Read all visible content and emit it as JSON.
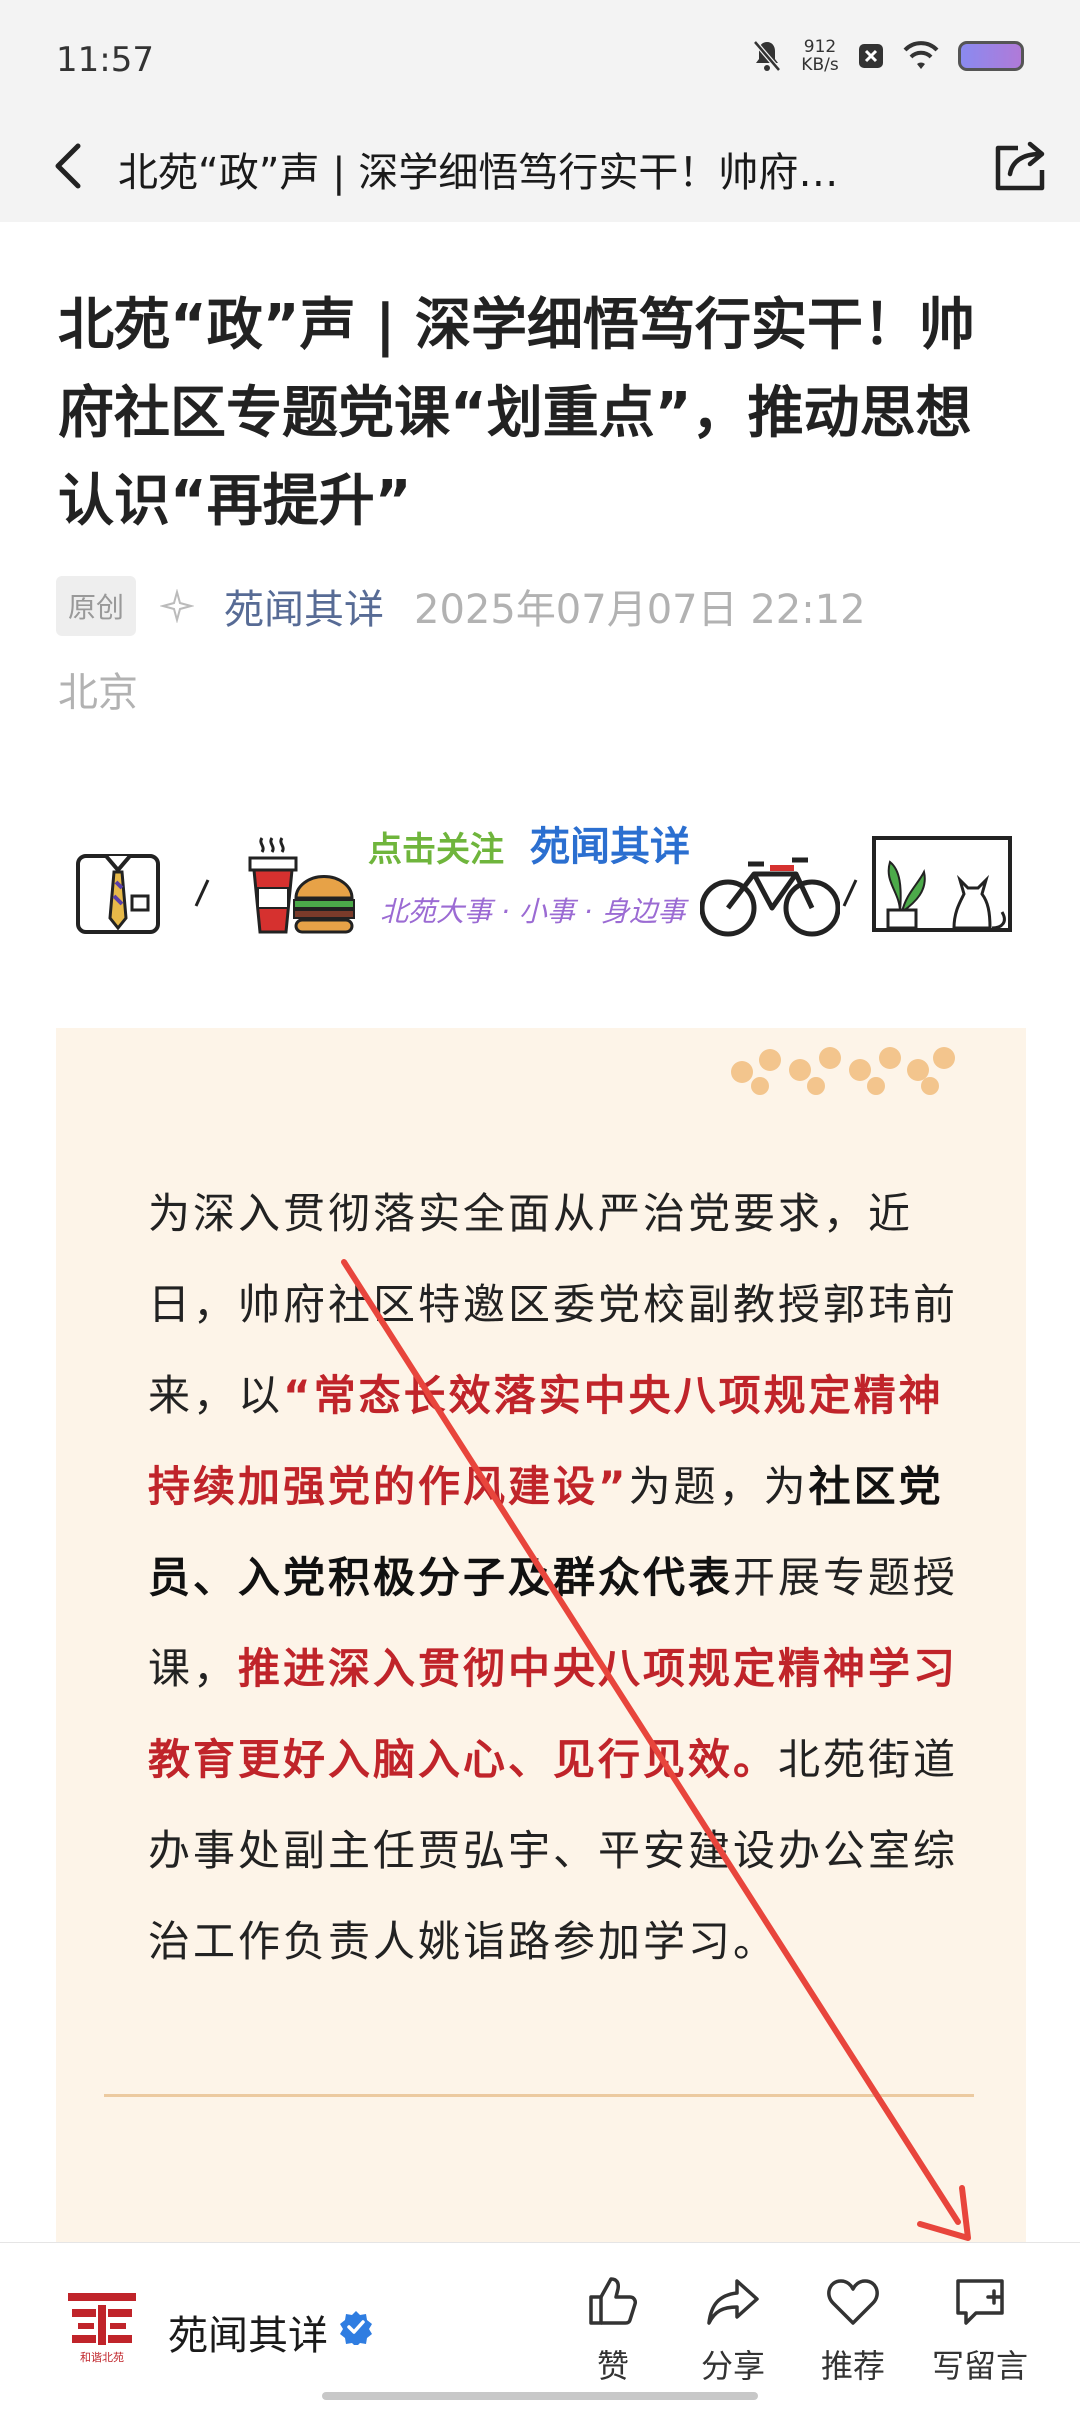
{
  "status_bar": {
    "time": "11:57",
    "net_speed_value": "912",
    "net_speed_unit": "KB/s",
    "icons": [
      "bell-muted-icon",
      "x-icon",
      "wifi-icon",
      "battery-icon"
    ]
  },
  "nav": {
    "title": "北苑“政”声 | 深学细悟笃行实干！帅府…",
    "back_icon": "chevron-left-icon",
    "share_icon": "share-icon"
  },
  "article": {
    "title": "北苑“政”声 | 深学细悟笃行实干！帅府社区专题党课“划重点”，推动思想认识“再提升”",
    "badge": "原创",
    "author": "苑闻其详",
    "publish_time": "2025年07月07日 22:12",
    "location": "北京"
  },
  "banner": {
    "follow_text": "点击关注",
    "account_name": "苑闻其详",
    "slogan": "北苑大事 · 小事 · 身边事",
    "icons": [
      "shirt-icon",
      "coffee-burger-icon",
      "bicycle-icon",
      "plant-cat-icon"
    ]
  },
  "content": {
    "p1": "为深入贯彻落实全面从严治党要求，近日，帅府社区特邀区委党校副教授郭玮前来，以",
    "p2": "“常态长效落实中央八项规定精神 持续加强党的作风建设”",
    "p3": "为题，为",
    "p4": "社区党员、入党积极分子及群众代表",
    "p5": "开展专题授课，",
    "p6": "推进深入贯彻中央八项规定精神学习教育更好入脑入心、见行见效。",
    "p7": "北苑街道办事处副主任贾弘宇、平安建设办公室综治工作负责人姚诣路参加学习。"
  },
  "bottom_bar": {
    "account_name": "苑闻其详",
    "logo_caption": "和谐北苑",
    "actions": [
      {
        "label": "赞",
        "icon": "thumbs-up-icon"
      },
      {
        "label": "分享",
        "icon": "share-arrow-icon"
      },
      {
        "label": "推荐",
        "icon": "heart-icon"
      },
      {
        "label": "写留言",
        "icon": "comment-add-icon"
      }
    ]
  },
  "colors": {
    "accent_red": "#c0242a",
    "link_blue": "#576b95",
    "card_bg": "#fdf4e8",
    "annotation_arrow": "#e8453c"
  }
}
